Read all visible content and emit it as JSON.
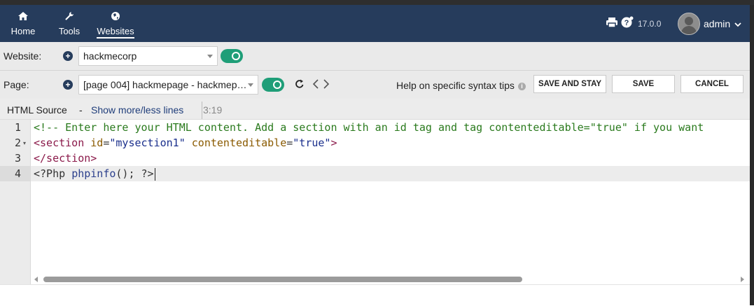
{
  "nav": {
    "home": "Home",
    "tools": "Tools",
    "websites": "Websites"
  },
  "header": {
    "version": "17.0.0",
    "user": "admin"
  },
  "website_row": {
    "label": "Website:",
    "selected": "hackmecorp"
  },
  "page_row": {
    "label": "Page:",
    "selected": "[page 004] hackmepage - hackmep…",
    "help": "Help on specific syntax tips",
    "save_and_stay": "SAVE AND STAY",
    "save": "SAVE",
    "cancel": "CANCEL"
  },
  "source_bar": {
    "title": "HTML Source",
    "separator": "-",
    "toggle_link": "Show more/less lines",
    "cursor_pos": "3:19"
  },
  "editor": {
    "line_numbers": [
      "1",
      "2",
      "3",
      "4"
    ],
    "line1": "<!-- Enter here your HTML content. Add a section with an id tag and tag contenteditable=\"true\" if you want",
    "line2_open": "<section",
    "line2_attr1": "id",
    "line2_eq1": "=",
    "line2_val1": "\"mysection1\"",
    "line2_attr2": "contenteditable",
    "line2_eq2": "=",
    "line2_val2": "\"true\"",
    "line2_close": ">",
    "line3": "</section>",
    "line4_open": "<?Php ",
    "line4_fn": "phpinfo",
    "line4_rest": "(); ?>"
  },
  "colors": {
    "header_bg": "#263c5c",
    "toggle_on": "#1f9e78",
    "link": "#1f3d7a"
  }
}
